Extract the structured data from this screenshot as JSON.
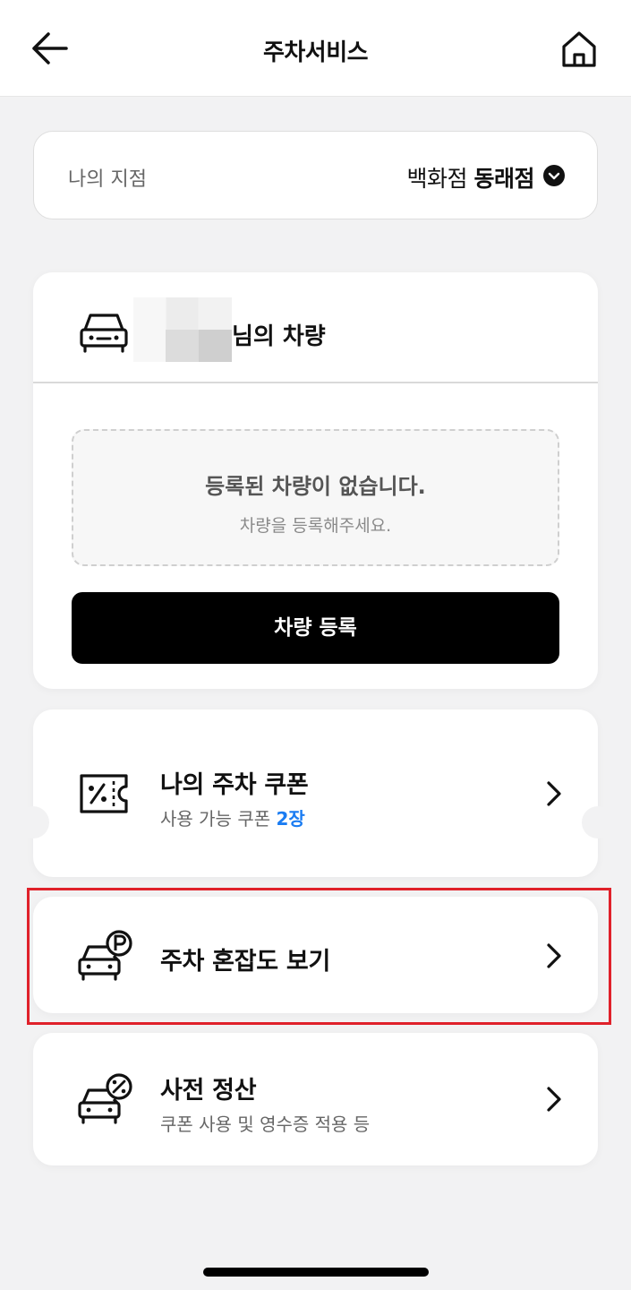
{
  "header": {
    "title": "주차서비스",
    "back_icon": "arrow-left-icon",
    "home_icon": "home-icon"
  },
  "branch": {
    "label": "나의 지점",
    "value_prefix": "백화점",
    "value_name": "동래점",
    "dropdown_icon": "chevron-down-circle-icon"
  },
  "vehicle": {
    "name_suffix": "님의 차량",
    "empty_title": "등록된 차량이 없습니다.",
    "empty_sub": "차량을 등록해주세요.",
    "register_label": "차량 등록"
  },
  "menu": {
    "coupon": {
      "title": "나의 주차 쿠폰",
      "sub_prefix": "사용 가능 쿠폰",
      "sub_count": "2장"
    },
    "congestion": {
      "title": "주차 혼잡도 보기"
    },
    "prepay": {
      "title": "사전 정산",
      "sub": "쿠폰 사용 및 영수증 적용 등"
    }
  },
  "colors": {
    "accent_blue": "#1a7cf2",
    "highlight_red": "#e0212a",
    "button_black": "#000000"
  }
}
